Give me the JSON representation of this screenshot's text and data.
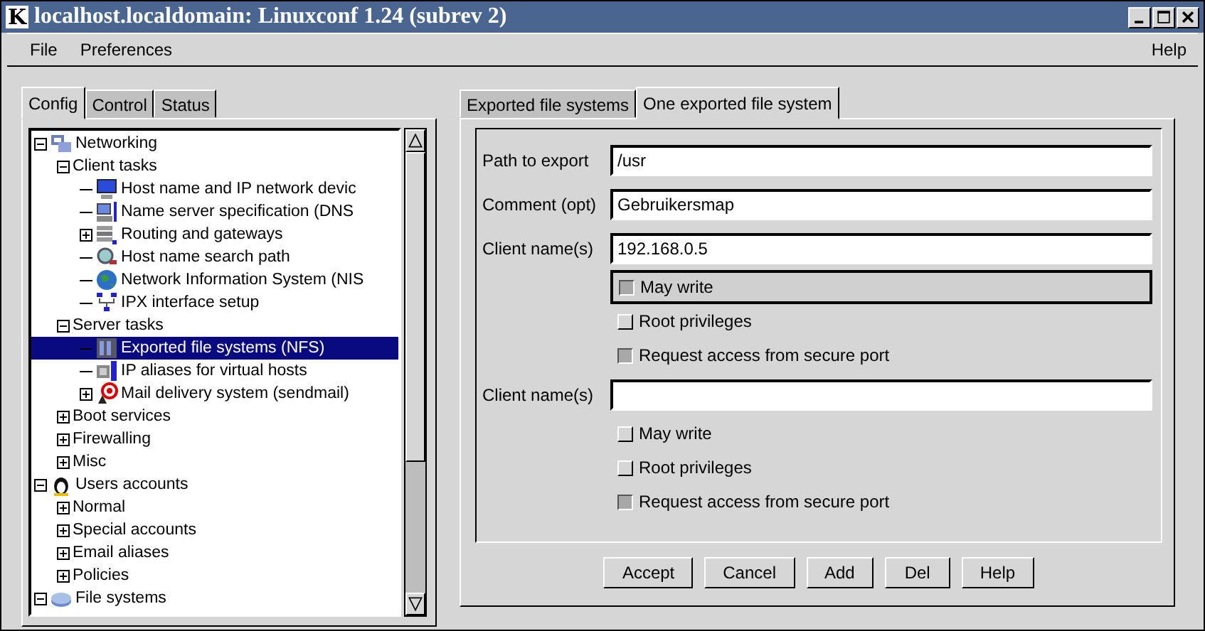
{
  "window": {
    "app_icon": "K",
    "title": "localhost.localdomain: Linuxconf 1.24 (subrev 2)"
  },
  "menu": {
    "left": [
      "File",
      "Preferences"
    ],
    "right": [
      "Help"
    ]
  },
  "left_tabs": [
    {
      "label": "Config",
      "selected": true
    },
    {
      "label": "Control",
      "selected": false
    },
    {
      "label": "Status",
      "selected": false
    }
  ],
  "tree": [
    {
      "label": "Networking",
      "expanded": true,
      "selected": false,
      "children": [
        {
          "label": "Client tasks",
          "expanded": true,
          "selected": false,
          "children": [
            {
              "label": "Host name and IP network devic",
              "selected": false
            },
            {
              "label": "Name server specification (DNS",
              "selected": false
            },
            {
              "label": "Routing and gateways",
              "expanded": false,
              "selected": false
            },
            {
              "label": "Host name search path",
              "selected": false
            },
            {
              "label": "Network Information System (NIS",
              "selected": false
            },
            {
              "label": "IPX interface setup",
              "selected": false
            }
          ]
        },
        {
          "label": "Server tasks",
          "expanded": true,
          "selected": false,
          "children": [
            {
              "label": "Exported file systems (NFS)",
              "selected": true
            },
            {
              "label": "IP aliases for virtual hosts",
              "selected": false
            },
            {
              "label": "Mail delivery system (sendmail)",
              "expanded": false,
              "selected": false
            }
          ]
        },
        {
          "label": "Boot services",
          "expanded": false,
          "selected": false
        },
        {
          "label": "Firewalling",
          "expanded": false,
          "selected": false
        },
        {
          "label": "Misc",
          "expanded": false,
          "selected": false
        }
      ]
    },
    {
      "label": "Users accounts",
      "expanded": true,
      "selected": false,
      "children": [
        {
          "label": "Normal",
          "expanded": false,
          "selected": false
        },
        {
          "label": "Special accounts",
          "expanded": false,
          "selected": false
        },
        {
          "label": "Email aliases",
          "expanded": false,
          "selected": false
        },
        {
          "label": "Policies",
          "expanded": false,
          "selected": false
        }
      ]
    },
    {
      "label": "File systems",
      "expanded": true,
      "selected": false
    }
  ],
  "right_tabs": [
    {
      "label": "Exported file systems",
      "selected": false
    },
    {
      "label": "One exported file system",
      "selected": true
    }
  ],
  "form": [
    {
      "kind": "field",
      "label": "Path to export",
      "value": "/usr"
    },
    {
      "kind": "field",
      "label": "Comment (opt)",
      "value": "Gebruikersmap"
    },
    {
      "kind": "field",
      "label": "Client name(s)",
      "value": "192.168.0.5"
    },
    {
      "kind": "checkbox",
      "label": "May write",
      "checked": true,
      "focused": true
    },
    {
      "kind": "checkbox",
      "label": "Root privileges",
      "checked": false,
      "focused": false
    },
    {
      "kind": "checkbox",
      "label": "Request access from secure port",
      "checked": true,
      "focused": false
    },
    {
      "kind": "field",
      "label": "Client name(s)"
    },
    {
      "kind": "checkbox",
      "label": "May write",
      "checked": false,
      "focused": false
    },
    {
      "kind": "checkbox",
      "label": "Root privileges",
      "checked": false,
      "focused": false
    },
    {
      "kind": "checkbox",
      "label": "Request access from secure port",
      "checked": true,
      "focused": false
    }
  ],
  "buttons": [
    "Accept",
    "Cancel",
    "Add",
    "Del",
    "Help"
  ]
}
